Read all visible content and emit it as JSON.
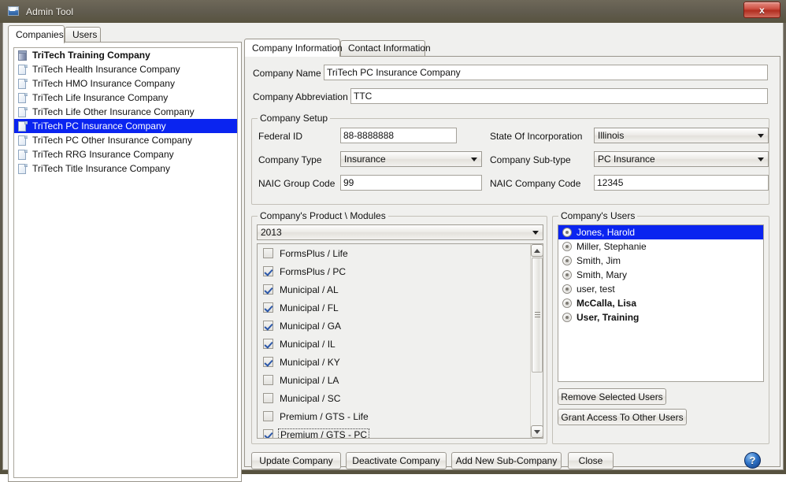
{
  "window": {
    "title": "Admin Tool",
    "icon": "app-icon",
    "close_label": "x"
  },
  "main_tabs": [
    {
      "label": "Companies",
      "active": true
    },
    {
      "label": "Users",
      "active": false
    }
  ],
  "companies": {
    "items": [
      {
        "label": "TriTech Training Company",
        "icon": "cube-icon",
        "bold": true,
        "selected": false
      },
      {
        "label": "TriTech Health Insurance Company",
        "icon": "folder-icon",
        "bold": false,
        "selected": false
      },
      {
        "label": "TriTech HMO Insurance Company",
        "icon": "folder-icon",
        "bold": false,
        "selected": false
      },
      {
        "label": "TriTech Life Insurance Company",
        "icon": "folder-icon",
        "bold": false,
        "selected": false
      },
      {
        "label": "TriTech Life Other Insurance Company",
        "icon": "folder-icon",
        "bold": false,
        "selected": false
      },
      {
        "label": "TriTech PC Insurance Company",
        "icon": "folder-icon",
        "bold": false,
        "selected": true
      },
      {
        "label": "TriTech PC Other Insurance Company",
        "icon": "folder-icon",
        "bold": false,
        "selected": false
      },
      {
        "label": "TriTech RRG Insurance Company",
        "icon": "folder-icon",
        "bold": false,
        "selected": false
      },
      {
        "label": "TriTech Title Insurance Company",
        "icon": "folder-icon",
        "bold": false,
        "selected": false
      }
    ]
  },
  "detail_tabs": [
    {
      "label": "Company Information",
      "active": true
    },
    {
      "label": "Contact Information",
      "active": false
    }
  ],
  "form": {
    "company_name_label": "Company Name",
    "company_name_value": "TriTech PC Insurance Company",
    "company_abbrev_label": "Company Abbreviation",
    "company_abbrev_value": "TTC",
    "setup_group_title": "Company Setup",
    "federal_id_label": "Federal ID",
    "federal_id_value": "88-8888888",
    "state_label": "State Of Incorporation",
    "state_value": "Illinois",
    "company_type_label": "Company Type",
    "company_type_value": "Insurance",
    "subtype_label": "Company Sub-type",
    "subtype_value": "PC Insurance",
    "naic_group_label": "NAIC Group Code",
    "naic_group_value": "99",
    "naic_company_label": "NAIC Company Code",
    "naic_company_value": "12345"
  },
  "modules": {
    "group_title": "Company's Product \\ Modules",
    "year_value": "2013",
    "items": [
      {
        "label": "FormsPlus / Life",
        "checked": false,
        "focused": false
      },
      {
        "label": "FormsPlus / PC",
        "checked": true,
        "focused": false
      },
      {
        "label": "Municipal / AL",
        "checked": true,
        "focused": false
      },
      {
        "label": "Municipal / FL",
        "checked": true,
        "focused": false
      },
      {
        "label": "Municipal / GA",
        "checked": true,
        "focused": false
      },
      {
        "label": "Municipal / IL",
        "checked": true,
        "focused": false
      },
      {
        "label": "Municipal / KY",
        "checked": true,
        "focused": false
      },
      {
        "label": "Municipal / LA",
        "checked": false,
        "focused": false
      },
      {
        "label": "Municipal / SC",
        "checked": false,
        "focused": false
      },
      {
        "label": "Premium / GTS - Life",
        "checked": false,
        "focused": false
      },
      {
        "label": "Premium / GTS - PC",
        "checked": true,
        "focused": true
      }
    ]
  },
  "users": {
    "group_title": "Company's Users",
    "items": [
      {
        "label": "Jones, Harold",
        "icon": "gear-icon",
        "selected": true,
        "bold": false
      },
      {
        "label": "Miller, Stephanie",
        "icon": "gear-icon",
        "selected": false,
        "bold": false
      },
      {
        "label": "Smith, Jim",
        "icon": "gear-icon",
        "selected": false,
        "bold": false
      },
      {
        "label": "Smith, Mary",
        "icon": "gear-icon",
        "selected": false,
        "bold": false
      },
      {
        "label": "user, test",
        "icon": "gear-icon",
        "selected": false,
        "bold": false
      },
      {
        "label": "McCalla, Lisa",
        "icon": "gear-icon",
        "selected": false,
        "bold": true
      },
      {
        "label": "User, Training",
        "icon": "gear-icon",
        "selected": false,
        "bold": true
      }
    ],
    "remove_button": "Remove Selected Users",
    "grant_button": "Grant Access To Other Users"
  },
  "actions": {
    "update": "Update Company",
    "deactivate": "Deactivate Company",
    "add_sub": "Add New Sub-Company",
    "close": "Close",
    "help": "?"
  },
  "colors": {
    "selection": "#0a24f0",
    "titlebar": "#5f5a4e",
    "close_button": "#b02e20",
    "checkmark": "#2a56a8",
    "help": "#2f74c8"
  }
}
